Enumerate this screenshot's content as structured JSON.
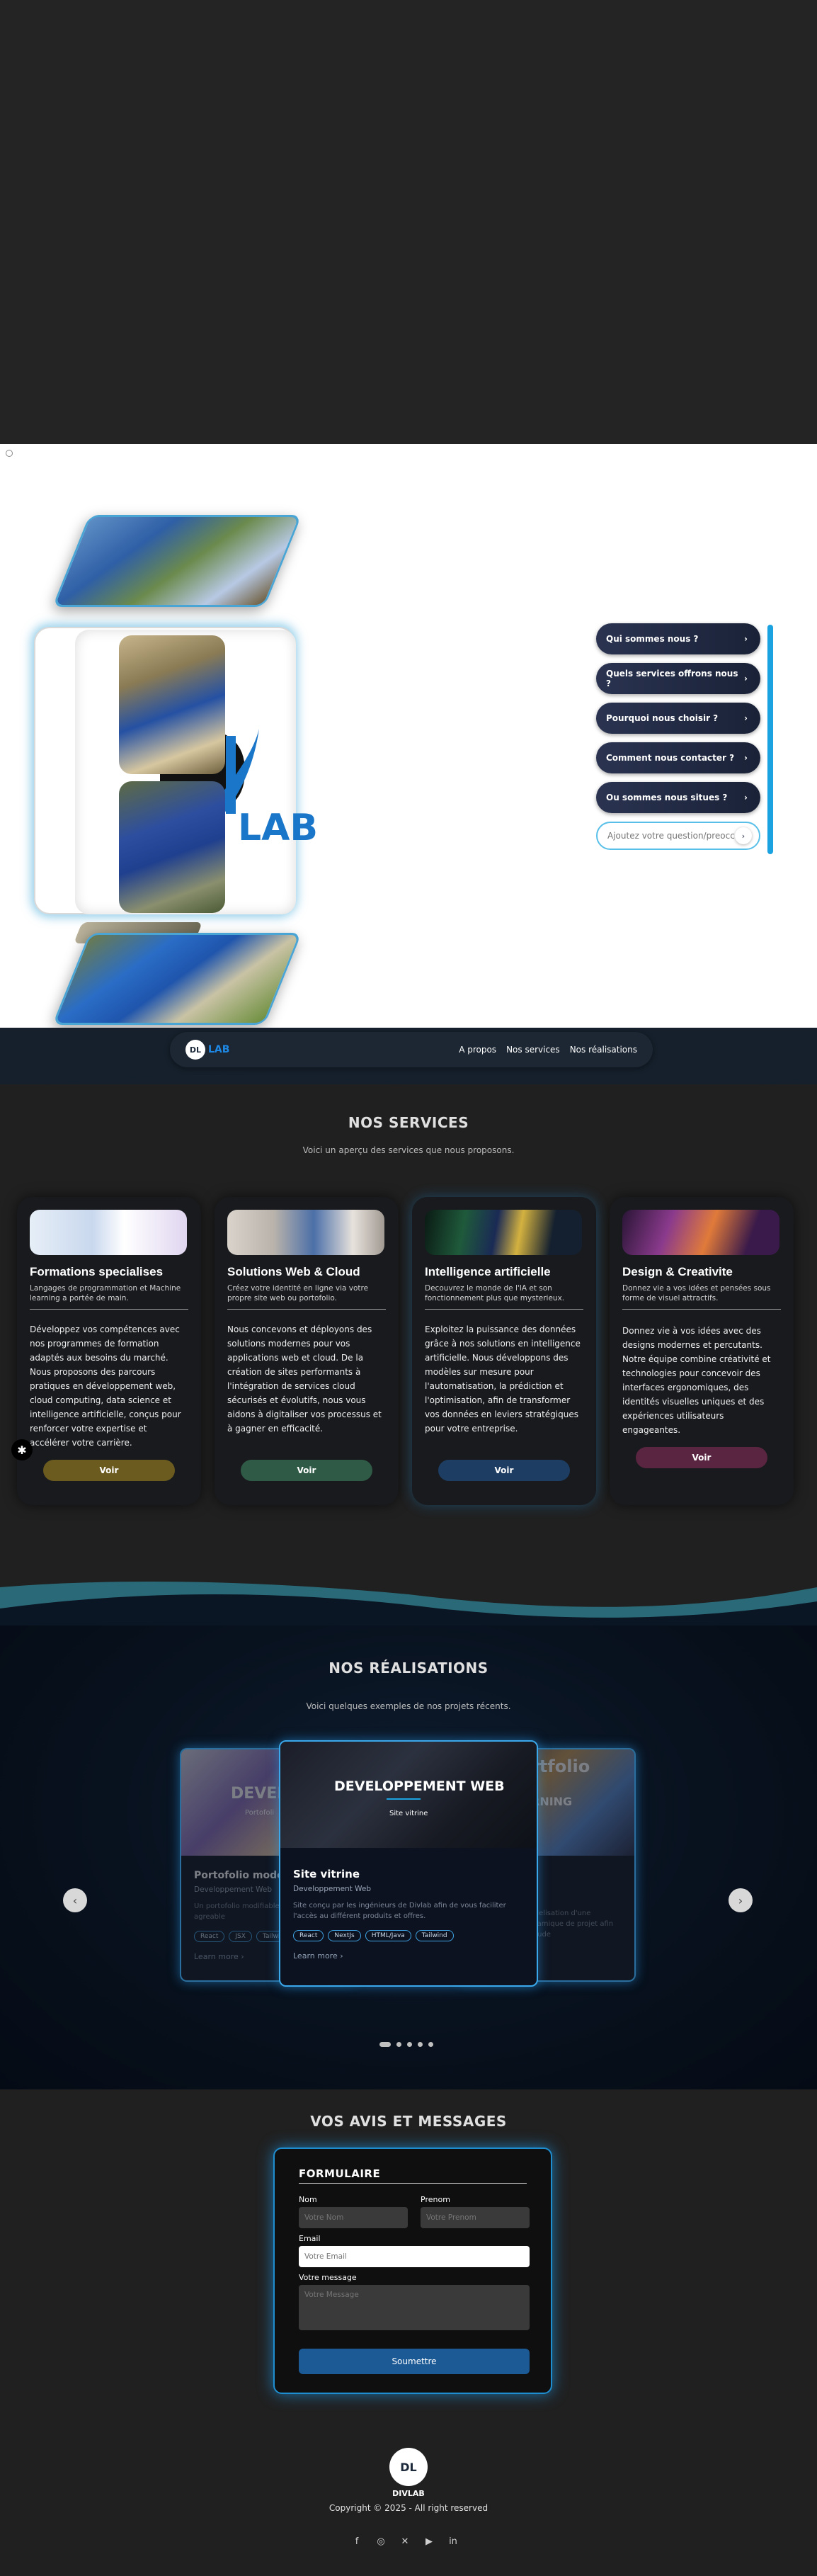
{
  "chatbot": {
    "questions": [
      "Qui sommes nous ?",
      "Quels services offrons nous ?",
      "Pourquoi nous choisir ?",
      "Comment nous contacter ?",
      "Ou sommes nous situes ?"
    ],
    "input_placeholder": "Ajoutez votre question/preoccupation"
  },
  "hero": {
    "logo_text": "LAB"
  },
  "nav": {
    "logo_initials": "DL",
    "logo_text": "LAB",
    "links": [
      "A propos",
      "Nos services",
      "Nos réalisations"
    ]
  },
  "services": {
    "title": "NOS SERVICES",
    "subtitle": "Voici un aperçu des services que nous proposons.",
    "cards": [
      {
        "title": "Formations specialises",
        "subtitle": "Langages de programmation et Machine learning a portée de main.",
        "description": "Développez vos compétences avec nos programmes de formation adaptés aux besoins du marché. Nous proposons des parcours pratiques en développement web, cloud computing, data science et intelligence artificielle, conçus pour renforcer votre expertise et accélérer votre carrière.",
        "button": "Voir",
        "button_color": "#6b5b1f"
      },
      {
        "title": "Solutions Web & Cloud",
        "subtitle": "Créez votre identité en ligne via votre propre site web ou portofolio.",
        "description": "Nous concevons et déployons des solutions modernes pour vos applications web et cloud. De la création de sites performants à l'intégration de services cloud sécurisés et évolutifs, nous vous aidons à digitaliser vos processus et à gagner en efficacité.",
        "button": "Voir",
        "button_color": "#2f5a46"
      },
      {
        "title": "Intelligence artificielle",
        "subtitle": "Decouvrez le monde de l'IA et son fonctionnement plus que mysterieux.",
        "description": "Exploitez la puissance des données grâce à nos solutions en intelligence artificielle. Nous développons des modèles sur mesure pour l'automatisation, la prédiction et l'optimisation, afin de transformer vos données en leviers stratégiques pour votre entreprise.",
        "button": "Voir",
        "button_color": "#1d3d63"
      },
      {
        "title": "Design & Creativite",
        "subtitle": "Donnez vie a vos idées et pensées sous forme de visuel attractifs.",
        "description": "Donnez vie à vos idées avec des designs modernes et percutants. Notre équipe combine créativité et technologies pour concevoir des interfaces ergonomiques, des identités visuelles uniques et des expériences utilisateurs engageantes.",
        "button": "Voir",
        "button_color": "#5a2540"
      }
    ]
  },
  "realisations": {
    "title": "NOS RÉALISATIONS",
    "subtitle": "Voici quelques exemples de nos projets récents.",
    "left_card": {
      "banner": "DEVELO",
      "banner_sub": "Portofoli",
      "title": "Portofolio mode",
      "category": "Developpement Web",
      "description": "Un portofolio modifiable a tout coeur et agreable",
      "tags": [
        "React",
        "JSX",
        "Tailwind"
      ],
      "more": "Learn more"
    },
    "center_card": {
      "banner": "DEVELOPPEMENT WEB",
      "banner_sub": "Site vitrine",
      "title": "Site vitrine",
      "category": "Developpement Web",
      "description": "Site conçu par les ingénieurs de Divlab afin de vous faciliter l'accès au différent produits et offres.",
      "tags": [
        "React",
        "NextJs",
        "HTML/Java",
        "Tailwind"
      ],
      "more": "Learn more"
    },
    "right_card": {
      "banner": "rtfolio",
      "banner_sub": "RNING",
      "description": "Modelisation d'une dynamique de projet afin d'etude",
      "more": ""
    },
    "prev": "‹",
    "next": "›",
    "dot_count": 5
  },
  "form": {
    "section_title": "VOS AVIS ET MESSAGES",
    "heading": "FORMULAIRE",
    "nom_label": "Nom",
    "nom_placeholder": "Votre Nom",
    "prenom_label": "Prenom",
    "prenom_placeholder": "Votre Prenom",
    "email_label": "Email",
    "email_placeholder": "Votre Email",
    "message_label": "Votre message",
    "message_placeholder": "Votre Message",
    "submit": "Soumettre"
  },
  "footer": {
    "logo_initials": "DL",
    "name": "DIVLAB",
    "copyright": "Copyright © 2025 - All right reserved",
    "socials": [
      "facebook-icon",
      "instagram-icon",
      "x-icon",
      "youtube-icon",
      "linkedin-icon"
    ]
  },
  "colors": {
    "accent": "#1aa3e0",
    "brand_blue": "#1976c9",
    "nav_bg": "#15202c"
  }
}
